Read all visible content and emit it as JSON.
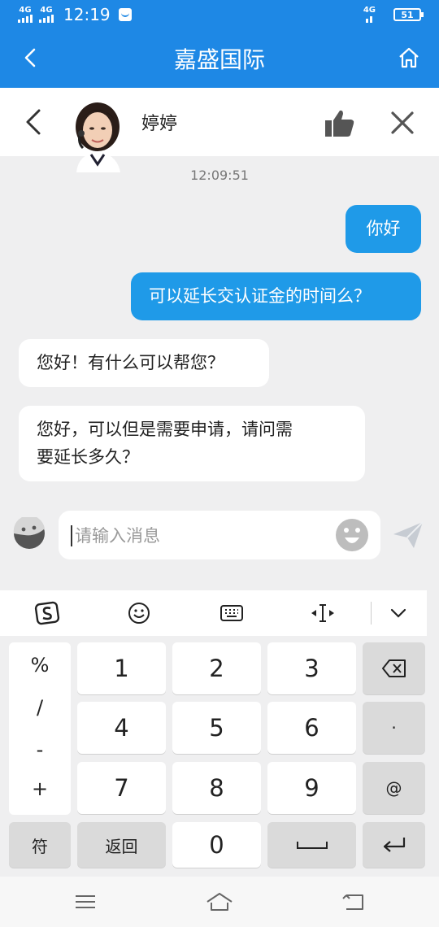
{
  "status_bar": {
    "network_1": "4G",
    "network_2": "4G",
    "time": "12:19",
    "right_network": "4G",
    "battery": "51"
  },
  "header": {
    "title": "嘉盛国际"
  },
  "chat_header": {
    "agent_name": "婷婷"
  },
  "messages": {
    "timestamp": "12:09:51",
    "m1": "你好",
    "m2": "可以延长交认证金的时间么？",
    "m3": "您好！有什么可以帮您？",
    "m4_line1": "您好，可以但是需要申请，请问需",
    "m4_line2": "要延长多久？"
  },
  "input": {
    "placeholder": "请输入消息"
  },
  "keyboard": {
    "symbols": [
      "%",
      "/",
      "-",
      "+"
    ],
    "digits": [
      "1",
      "2",
      "3",
      "4",
      "5",
      "6",
      "7",
      "8",
      "9",
      "0"
    ],
    "dot": "·",
    "at": "@",
    "fu": "符",
    "back_label": "返回"
  },
  "colors": {
    "brand_blue": "#1e88e5",
    "bubble_out": "#1f9ae8"
  }
}
